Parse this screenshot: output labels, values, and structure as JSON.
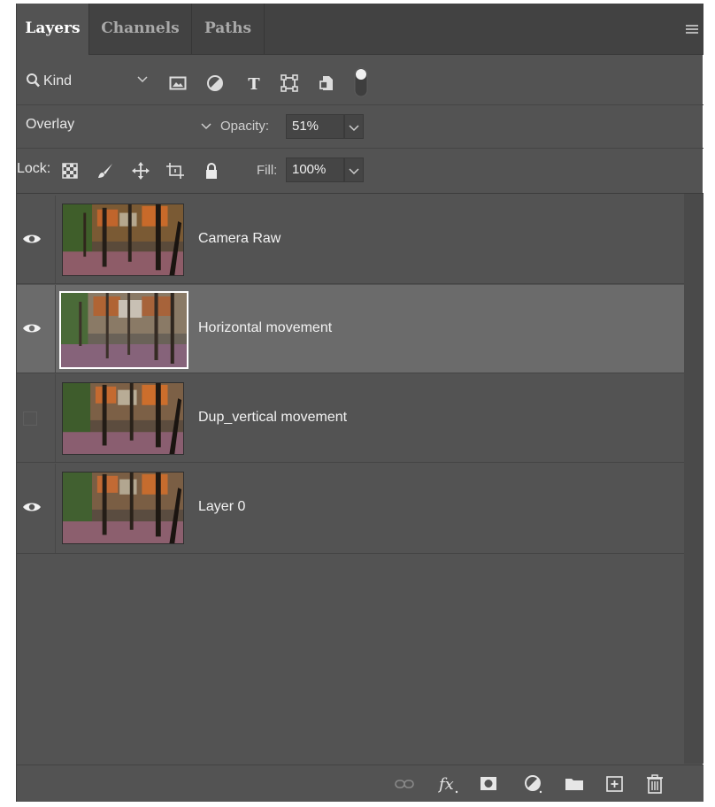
{
  "tabs": [
    {
      "label": "Layers",
      "active": true
    },
    {
      "label": "Channels",
      "active": false
    },
    {
      "label": "Paths",
      "active": false
    }
  ],
  "filter": {
    "kind_label": "Kind",
    "icons": [
      "image-filter-icon",
      "adjustment-filter-icon",
      "type-filter-icon",
      "shape-filter-icon",
      "smart-object-filter-icon",
      "filter-toggle-icon"
    ]
  },
  "blend": {
    "mode": "Overlay",
    "opacity_label": "Opacity:",
    "opacity_value": "51%"
  },
  "lock": {
    "label": "Lock:",
    "icons": [
      "lock-transparent-pixels-icon",
      "lock-image-pixels-icon",
      "lock-position-icon",
      "lock-artboard-icon",
      "lock-all-icon"
    ],
    "fill_label": "Fill:",
    "fill_value": "100%"
  },
  "layers": [
    {
      "name": "Camera Raw",
      "visible": true,
      "selected": false
    },
    {
      "name": "Horizontal movement",
      "visible": true,
      "selected": true
    },
    {
      "name": "Dup_vertical movement",
      "visible": false,
      "selected": false
    },
    {
      "name": "Layer 0",
      "visible": true,
      "selected": false
    }
  ],
  "bottom_icons": [
    "link-layers-icon",
    "fx-icon",
    "add-mask-icon",
    "new-adjustment-layer-icon",
    "new-group-icon",
    "new-layer-icon",
    "delete-layer-icon"
  ],
  "colors": {
    "panel": "#535353",
    "selected_row": "#6b6b6b",
    "tabbar": "#424242"
  }
}
